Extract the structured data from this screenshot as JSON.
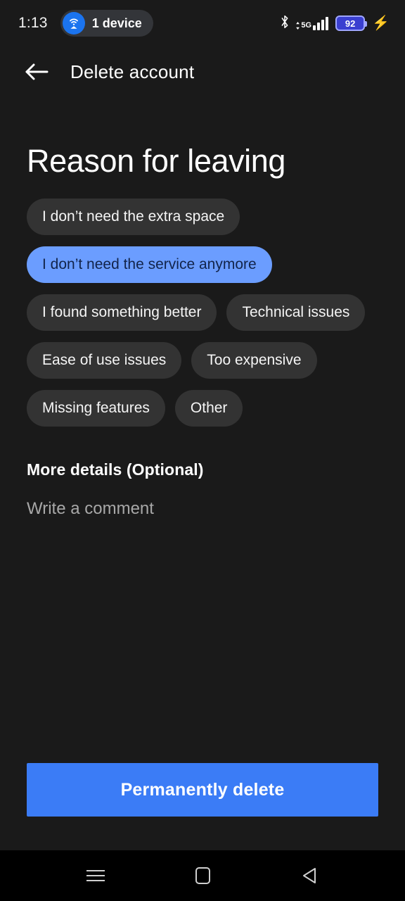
{
  "status_bar": {
    "clock": "1:13",
    "device_pill": {
      "icon": "hotspot-icon",
      "label": "1 device"
    },
    "bluetooth_icon": "bluetooth-icon",
    "network_type": "5G",
    "signal_bars": 4,
    "battery_percent": "92",
    "charging_icon": "charging-bolt-icon",
    "colors": {
      "accent_blue": "#1b74ef",
      "battery_fill": "#3a3fd0",
      "bolt": "#6c63ff"
    }
  },
  "app_bar": {
    "back_icon": "arrow-left-icon",
    "title": "Delete account"
  },
  "main": {
    "page_title": "Reason for leaving",
    "reasons": [
      {
        "label": "I don’t need the extra space",
        "selected": false
      },
      {
        "label": "I don’t need the service anymore",
        "selected": true
      },
      {
        "label": "I found something better",
        "selected": false
      },
      {
        "label": "Technical issues",
        "selected": false
      },
      {
        "label": "Ease of use issues",
        "selected": false
      },
      {
        "label": "Too expensive",
        "selected": false
      },
      {
        "label": "Missing features",
        "selected": false
      },
      {
        "label": "Other",
        "selected": false
      }
    ],
    "details_label": "More details (Optional)",
    "comment": {
      "value": "",
      "placeholder": "Write a comment"
    },
    "primary_action": "Permanently delete",
    "colors": {
      "background": "#1a1a1a",
      "chip": "#333333",
      "chip_selected": "#6b9dff",
      "chip_selected_text": "#12244a",
      "primary_button": "#3b7cf6"
    }
  },
  "nav_bar": {
    "recents_icon": "menu-lines-icon",
    "home_icon": "square-icon",
    "back_icon": "triangle-left-icon"
  }
}
